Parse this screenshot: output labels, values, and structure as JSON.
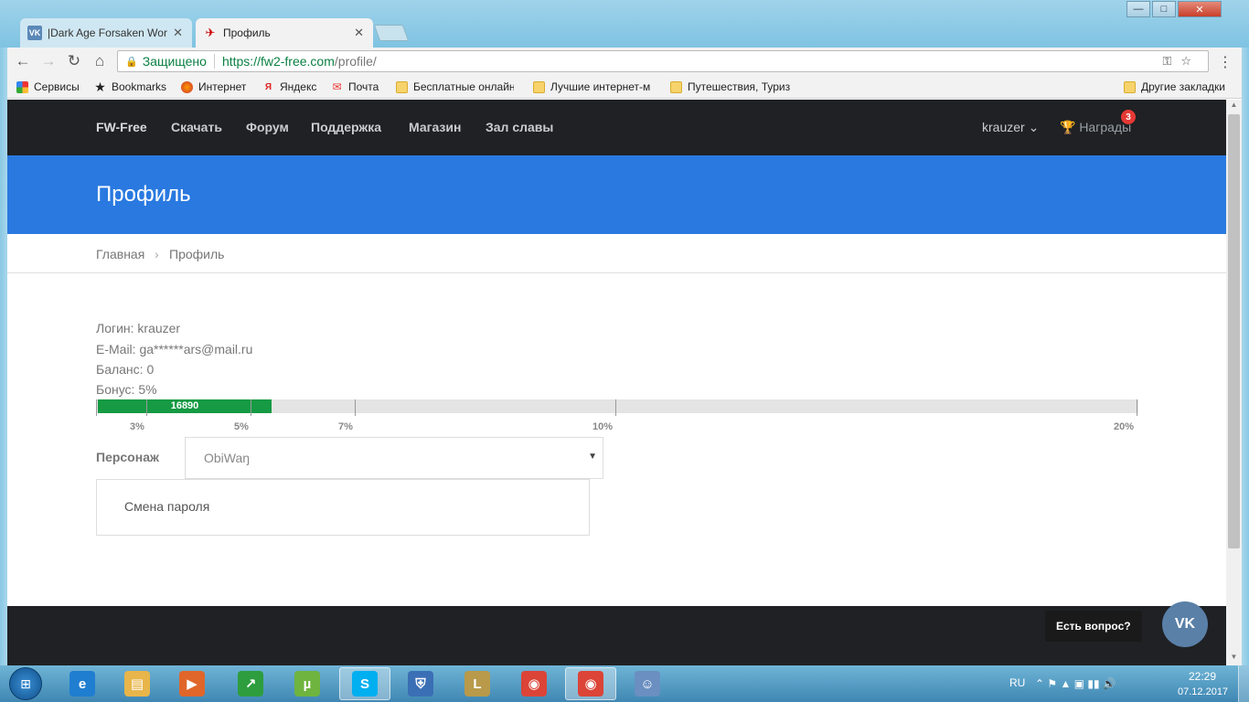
{
  "browser": {
    "tabs": [
      {
        "label": "|Dark Age Forsaken Wor",
        "favicon": "VK",
        "close": "✕"
      },
      {
        "label": "Профиль",
        "favicon": "✈",
        "close": "✕"
      }
    ],
    "secure_label": "Защищено",
    "url_scheme_host": "https://fw2-free.com",
    "url_path": "/profile/",
    "window_controls": {
      "minimize": "—",
      "maximize": "□",
      "close": "✕"
    },
    "nav": {
      "back": "←",
      "forward": "→",
      "reload": "↻",
      "home": "⌂"
    },
    "omnibox_icons": "⚿☆",
    "menu": "⋮"
  },
  "bookmarks": [
    {
      "label": "Сервисы",
      "icon": "apps-icon"
    },
    {
      "label": "Bookmarks",
      "icon": "star-icon"
    },
    {
      "label": "Интернет",
      "icon": "firefox-icon"
    },
    {
      "label": "Яндекс",
      "icon": "yandex-icon"
    },
    {
      "label": "Почта",
      "icon": "mail-icon"
    },
    {
      "label": "Бесплатные онлайн",
      "icon": "folder-icon"
    },
    {
      "label": "Лучшие интернет-м",
      "icon": "folder-icon"
    },
    {
      "label": "Путешествия, Туриз",
      "icon": "folder-icon"
    },
    {
      "label": "Другие закладки",
      "icon": "folder-icon"
    }
  ],
  "site": {
    "brand": "FW-Free",
    "nav": [
      "Скачать",
      "Форум",
      "Поддержка",
      "Магазин",
      "Зал славы"
    ],
    "user": "krauzer ⌄",
    "awards": "🏆 Награды",
    "awards_badge": "3",
    "page_title": "Профиль",
    "breadcrumb": {
      "home": "Главная",
      "separator": "›",
      "current": "Профиль"
    }
  },
  "profile": {
    "login": "Логин: krauzer",
    "email": "E-Mail: ga******ars@mail.ru",
    "balance": "Баланс: 0",
    "bonus": "Бонус: 5%",
    "progress": {
      "value_label": "16890",
      "fill_fraction": 0.167,
      "labels": [
        "3%",
        "5%",
        "7%",
        "10%",
        "20%"
      ]
    },
    "character_label": "Персонаж",
    "character_value": "ObiWaŋ",
    "caret": "▼",
    "change_password": "Смена пароля"
  },
  "widget": {
    "question": "Есть вопрос?",
    "vk": "VK"
  },
  "taskbar": {
    "apps": [
      {
        "name": "ie",
        "glyph": "e",
        "color": "#1f7ed0"
      },
      {
        "name": "explorer",
        "glyph": "▤",
        "color": "#e8b54a"
      },
      {
        "name": "media-player",
        "glyph": "▶",
        "color": "#e0662a"
      },
      {
        "name": "stocks",
        "glyph": "↗",
        "color": "#2e9d3e"
      },
      {
        "name": "utorrent",
        "glyph": "µ",
        "color": "#6fb43f"
      },
      {
        "name": "skype",
        "glyph": "S",
        "color": "#00aff0"
      },
      {
        "name": "update",
        "glyph": "⛨",
        "color": "#3b6fb5"
      },
      {
        "name": "league",
        "glyph": "L",
        "color": "#b89a4a"
      },
      {
        "name": "chrome",
        "glyph": "◉",
        "color": "#db4437"
      },
      {
        "name": "chrome-active",
        "glyph": "◉",
        "color": "#db4437"
      },
      {
        "name": "game",
        "glyph": "☺",
        "color": "#6a8fc0"
      }
    ],
    "lang": "RU",
    "tray_icons": "⌃ ⚑ ▲ ▣ ▮▮ 🔊",
    "time": "22:29",
    "date": "07.12.2017"
  }
}
